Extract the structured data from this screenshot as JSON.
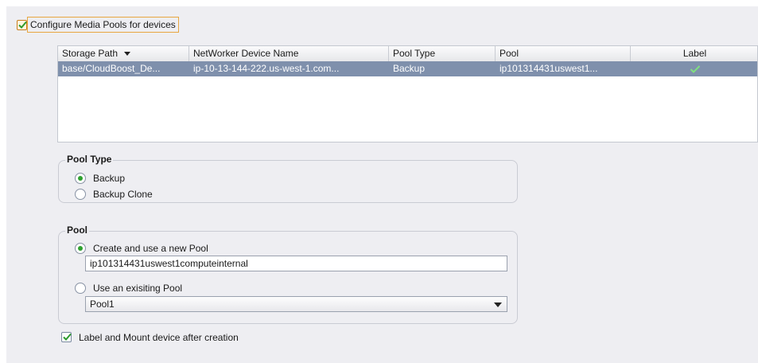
{
  "configure": {
    "label": "Configure Media Pools for devices",
    "checked": true
  },
  "table": {
    "columns": [
      "Storage Path",
      "NetWorker Device Name",
      "Pool Type",
      "Pool",
      "Label"
    ],
    "rows": [
      {
        "storage_path": "base/CloudBoost_De...",
        "device_name": "ip-10-13-144-222.us-west-1.com...",
        "pool_type": "Backup",
        "pool": "ip101314431uswest1...",
        "label_icon": "check-icon"
      }
    ]
  },
  "pool_type": {
    "title": "Pool Type",
    "options": [
      "Backup",
      "Backup Clone"
    ],
    "selected": "Backup"
  },
  "pool": {
    "title": "Pool",
    "create_label": "Create and use a new Pool",
    "new_pool_value": "ip101314431uswest1computeinternal",
    "existing_label": "Use an exisiting Pool",
    "existing_value": "Pool1",
    "selected": "create"
  },
  "label_mount": {
    "label": "Label and Mount device after creation",
    "checked": true
  },
  "colors": {
    "selection": "#7f90ac",
    "radio_on": "#2fa12f",
    "check": "#2e9b2e"
  }
}
